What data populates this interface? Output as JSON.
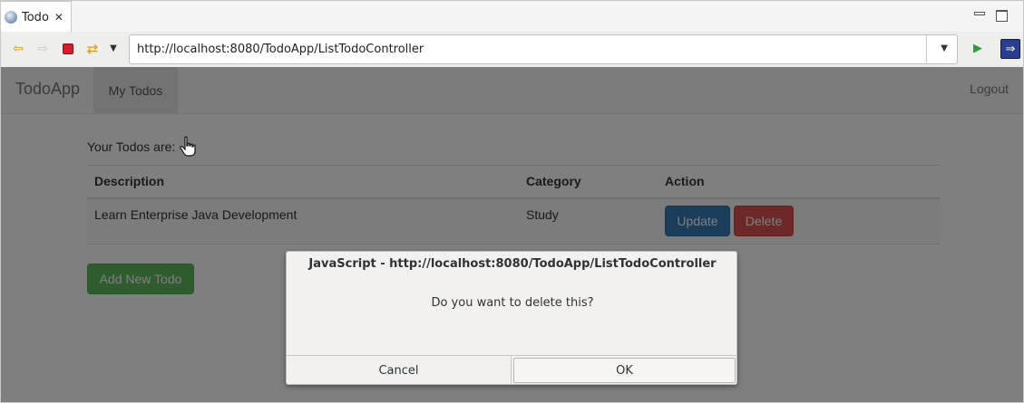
{
  "tab": {
    "title": "Todo",
    "close_glyph": "✕"
  },
  "toolbar": {
    "url": "http://localhost:8080/TodoApp/ListTodoController",
    "icons": [
      "back-icon",
      "forward-icon",
      "stop-icon",
      "refresh-icon",
      "dropdown-icon",
      "go-icon",
      "eclipse-icon"
    ]
  },
  "navbar": {
    "brand": "TodoApp",
    "active_item": "My Todos",
    "logout": "Logout"
  },
  "main": {
    "caption": "Your Todos are:",
    "columns": [
      "Description",
      "Category",
      "Action"
    ],
    "rows": [
      {
        "description": "Learn Enterprise Java Development",
        "category": "Study",
        "update_label": "Update",
        "delete_label": "Delete"
      }
    ],
    "add_button": "Add New Todo"
  },
  "dialog": {
    "title": "JavaScript - http://localhost:8080/TodoApp/ListTodoController",
    "message": "Do you want to delete this?",
    "cancel_label": "Cancel",
    "ok_label": "OK"
  },
  "colors": {
    "primary": "#337ab7",
    "danger": "#d9534f",
    "success": "#5cb85c",
    "stop": "#d21f2a"
  }
}
